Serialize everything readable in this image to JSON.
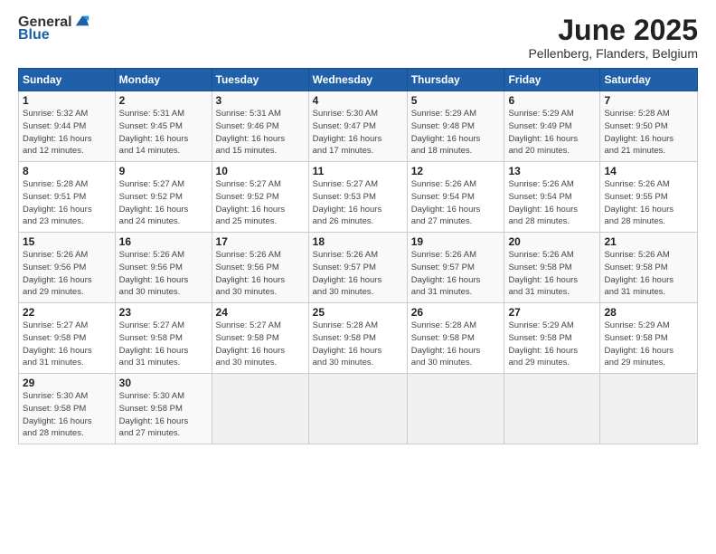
{
  "header": {
    "logo_general": "General",
    "logo_blue": "Blue",
    "month_title": "June 2025",
    "location": "Pellenberg, Flanders, Belgium"
  },
  "weekdays": [
    "Sunday",
    "Monday",
    "Tuesday",
    "Wednesday",
    "Thursday",
    "Friday",
    "Saturday"
  ],
  "weeks": [
    [
      {
        "day": "1",
        "sunrise": "5:32 AM",
        "sunset": "9:44 PM",
        "daylight": "16 hours and 12 minutes."
      },
      {
        "day": "2",
        "sunrise": "5:31 AM",
        "sunset": "9:45 PM",
        "daylight": "16 hours and 14 minutes."
      },
      {
        "day": "3",
        "sunrise": "5:31 AM",
        "sunset": "9:46 PM",
        "daylight": "16 hours and 15 minutes."
      },
      {
        "day": "4",
        "sunrise": "5:30 AM",
        "sunset": "9:47 PM",
        "daylight": "16 hours and 17 minutes."
      },
      {
        "day": "5",
        "sunrise": "5:29 AM",
        "sunset": "9:48 PM",
        "daylight": "16 hours and 18 minutes."
      },
      {
        "day": "6",
        "sunrise": "5:29 AM",
        "sunset": "9:49 PM",
        "daylight": "16 hours and 20 minutes."
      },
      {
        "day": "7",
        "sunrise": "5:28 AM",
        "sunset": "9:50 PM",
        "daylight": "16 hours and 21 minutes."
      }
    ],
    [
      {
        "day": "8",
        "sunrise": "5:28 AM",
        "sunset": "9:51 PM",
        "daylight": "16 hours and 23 minutes."
      },
      {
        "day": "9",
        "sunrise": "5:27 AM",
        "sunset": "9:52 PM",
        "daylight": "16 hours and 24 minutes."
      },
      {
        "day": "10",
        "sunrise": "5:27 AM",
        "sunset": "9:52 PM",
        "daylight": "16 hours and 25 minutes."
      },
      {
        "day": "11",
        "sunrise": "5:27 AM",
        "sunset": "9:53 PM",
        "daylight": "16 hours and 26 minutes."
      },
      {
        "day": "12",
        "sunrise": "5:26 AM",
        "sunset": "9:54 PM",
        "daylight": "16 hours and 27 minutes."
      },
      {
        "day": "13",
        "sunrise": "5:26 AM",
        "sunset": "9:54 PM",
        "daylight": "16 hours and 28 minutes."
      },
      {
        "day": "14",
        "sunrise": "5:26 AM",
        "sunset": "9:55 PM",
        "daylight": "16 hours and 28 minutes."
      }
    ],
    [
      {
        "day": "15",
        "sunrise": "5:26 AM",
        "sunset": "9:56 PM",
        "daylight": "16 hours and 29 minutes."
      },
      {
        "day": "16",
        "sunrise": "5:26 AM",
        "sunset": "9:56 PM",
        "daylight": "16 hours and 30 minutes."
      },
      {
        "day": "17",
        "sunrise": "5:26 AM",
        "sunset": "9:56 PM",
        "daylight": "16 hours and 30 minutes."
      },
      {
        "day": "18",
        "sunrise": "5:26 AM",
        "sunset": "9:57 PM",
        "daylight": "16 hours and 30 minutes."
      },
      {
        "day": "19",
        "sunrise": "5:26 AM",
        "sunset": "9:57 PM",
        "daylight": "16 hours and 31 minutes."
      },
      {
        "day": "20",
        "sunrise": "5:26 AM",
        "sunset": "9:58 PM",
        "daylight": "16 hours and 31 minutes."
      },
      {
        "day": "21",
        "sunrise": "5:26 AM",
        "sunset": "9:58 PM",
        "daylight": "16 hours and 31 minutes."
      }
    ],
    [
      {
        "day": "22",
        "sunrise": "5:27 AM",
        "sunset": "9:58 PM",
        "daylight": "16 hours and 31 minutes."
      },
      {
        "day": "23",
        "sunrise": "5:27 AM",
        "sunset": "9:58 PM",
        "daylight": "16 hours and 31 minutes."
      },
      {
        "day": "24",
        "sunrise": "5:27 AM",
        "sunset": "9:58 PM",
        "daylight": "16 hours and 30 minutes."
      },
      {
        "day": "25",
        "sunrise": "5:28 AM",
        "sunset": "9:58 PM",
        "daylight": "16 hours and 30 minutes."
      },
      {
        "day": "26",
        "sunrise": "5:28 AM",
        "sunset": "9:58 PM",
        "daylight": "16 hours and 30 minutes."
      },
      {
        "day": "27",
        "sunrise": "5:29 AM",
        "sunset": "9:58 PM",
        "daylight": "16 hours and 29 minutes."
      },
      {
        "day": "28",
        "sunrise": "5:29 AM",
        "sunset": "9:58 PM",
        "daylight": "16 hours and 29 minutes."
      }
    ],
    [
      {
        "day": "29",
        "sunrise": "5:30 AM",
        "sunset": "9:58 PM",
        "daylight": "16 hours and 28 minutes."
      },
      {
        "day": "30",
        "sunrise": "5:30 AM",
        "sunset": "9:58 PM",
        "daylight": "16 hours and 27 minutes."
      },
      null,
      null,
      null,
      null,
      null
    ]
  ]
}
